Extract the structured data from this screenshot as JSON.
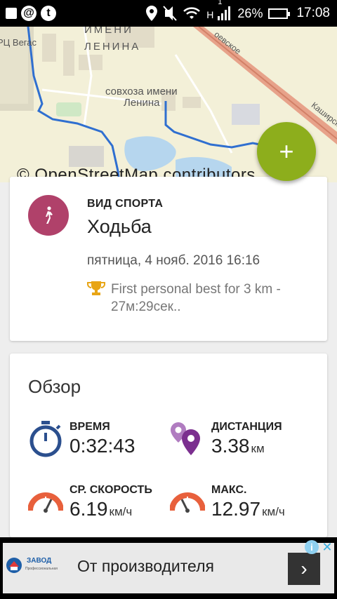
{
  "status_bar": {
    "left_icons": [
      "at-sign",
      "t-app"
    ],
    "network_label": "H",
    "signal_superscript": "1",
    "battery": "26%",
    "battery_level": 0.26,
    "time": "17:08"
  },
  "map": {
    "labels": [
      "ИМЕНИ",
      "ЛЕНИНА",
      "совхоза имени",
      "Ленина",
      "РЦ Вегас",
      "Каширск",
      "оевское"
    ],
    "attribution": "© OpenStreetMap contributors",
    "route_color": "#2f6fd0"
  },
  "fab": {
    "label": "+",
    "color": "#8dae1c"
  },
  "activity": {
    "sport_label": "ВИД СПОРТА",
    "sport_name": "Ходьба",
    "icon": "walking-person-icon",
    "icon_color": "#b0416a",
    "datetime": "пятница, 4 нояб. 2016 16:16",
    "personal_best": "First personal best for 3 km - 27м:29сек.."
  },
  "overview": {
    "title": "Обзор",
    "stats": [
      {
        "label": "ВРЕМЯ",
        "value": "0:32:43",
        "unit": "",
        "icon": "stopwatch-icon"
      },
      {
        "label": "ДИСТАНЦИЯ",
        "value": "3.38",
        "unit": "км",
        "icon": "map-pins-icon"
      },
      {
        "label": "СР. СКОРОСТЬ",
        "value": "6.19",
        "unit": "км/ч",
        "icon": "speedometer-icon"
      },
      {
        "label": "МАКС.",
        "value": "12.97",
        "unit": "км/ч",
        "icon": "speedometer-icon"
      }
    ]
  },
  "ad": {
    "text": "От производителя",
    "logo_text": "ЗАВОД",
    "logo_subtext": "Профессиональная",
    "action": "›",
    "info": "i",
    "close": "✕"
  }
}
